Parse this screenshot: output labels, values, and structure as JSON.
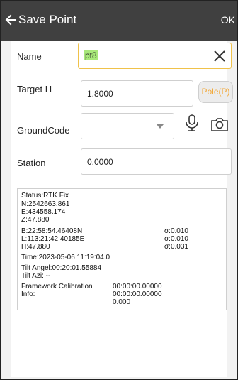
{
  "header": {
    "title": "Save Point",
    "ok_label": "OK"
  },
  "form": {
    "name_label": "Name",
    "name_value": "pt8",
    "target_h_label": "Target H",
    "target_h_value": "1.8000",
    "pole_button_label": "Pole(P)",
    "ground_code_label": "GroundCode",
    "ground_code_value": "",
    "station_label": "Station",
    "station_value": "0.0000"
  },
  "info": {
    "status": "Status:RTK Fix",
    "n": "N:2542663.861",
    "e": "E:434558.174",
    "z": "Z:47.880",
    "b": "B:22:58:54.46408N",
    "b_sigma": "σ:0.010",
    "l": "L:113:21:42.40185E",
    "l_sigma": "σ:0.010",
    "h": "H:47.880",
    "h_sigma": "σ:0.031",
    "time": "Time:2023-05-06 11:19:04.0",
    "tilt_angel": "Tilt Angel:00:20:01.55884",
    "tilt_azi": "Tilt Azi: --",
    "framework_label": "Framework Calibration",
    "info_label": "Info:",
    "framework_val1": "00:00:00.00000",
    "framework_val2": "00:00:00.00000",
    "framework_val3": "0.000"
  },
  "colors": {
    "titlebar": "#404040",
    "accent": "#f2a93a",
    "highlight": "#a8e87a",
    "active_border": "#f0c24a"
  },
  "icons": [
    "back-arrow-icon",
    "clear-icon",
    "chevron-down-icon",
    "microphone-icon",
    "camera-icon"
  ]
}
